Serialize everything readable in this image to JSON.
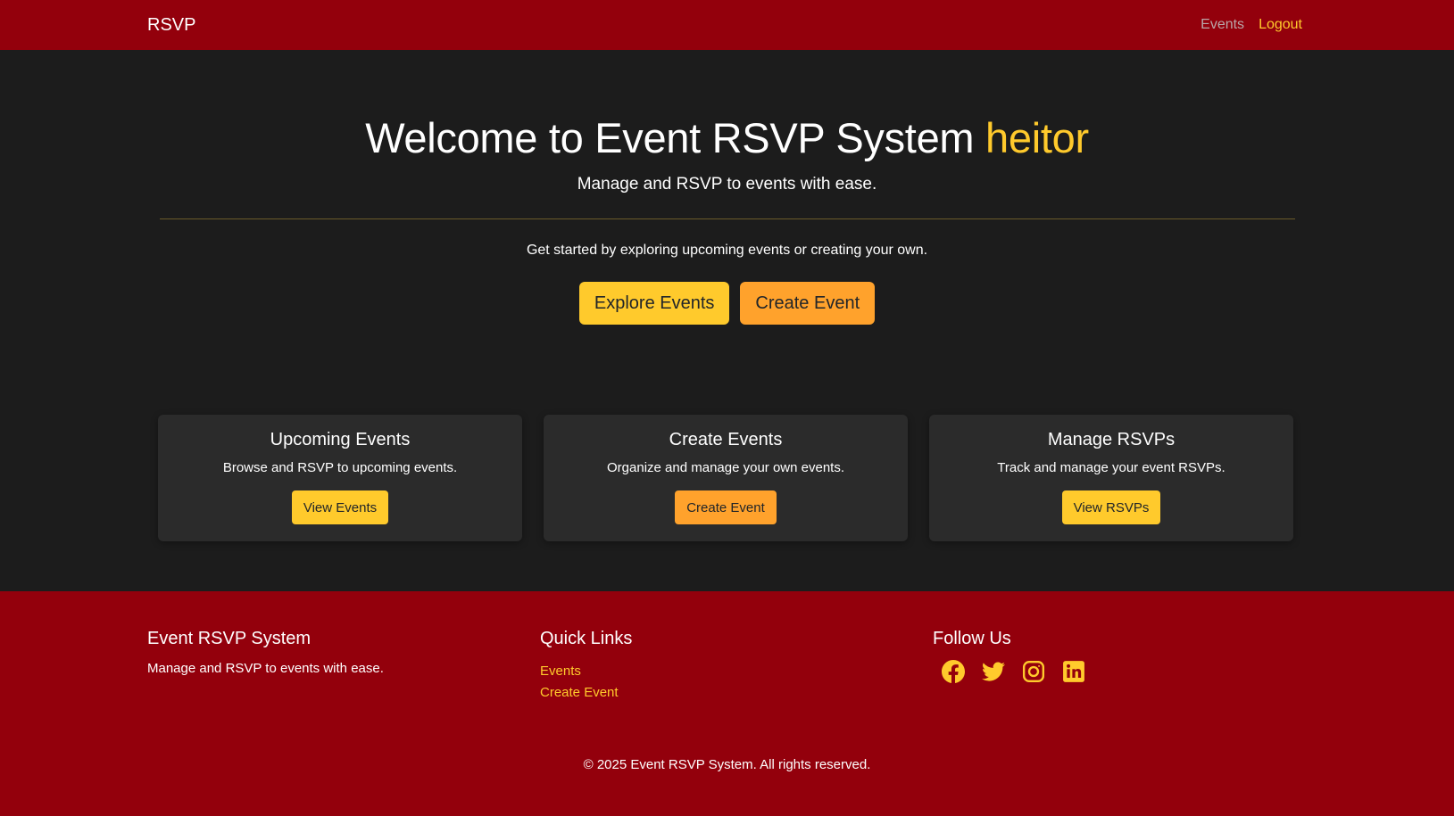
{
  "navbar": {
    "brand": "RSVP",
    "links": [
      {
        "label": "Events"
      },
      {
        "label": "Logout"
      }
    ]
  },
  "hero": {
    "title": "Welcome to Event RSVP System ",
    "username": "heitor",
    "subtitle": "Manage and RSVP to events with ease.",
    "intro": "Get started by exploring upcoming events or creating your own.",
    "buttons": {
      "explore": "Explore Events",
      "create": "Create Event"
    }
  },
  "cards": [
    {
      "title": "Upcoming Events",
      "text": "Browse and RSVP to upcoming events.",
      "button": "View Events"
    },
    {
      "title": "Create Events",
      "text": "Organize and manage your own events.",
      "button": "Create Event"
    },
    {
      "title": "Manage RSVPs",
      "text": "Track and manage your event RSVPs.",
      "button": "View RSVPs"
    }
  ],
  "footer": {
    "about": {
      "title": "Event RSVP System",
      "text": "Manage and RSVP to events with ease."
    },
    "quick_links": {
      "title": "Quick Links",
      "links": [
        "Events",
        "Create Event"
      ]
    },
    "follow": {
      "title": "Follow Us",
      "icons": [
        "facebook-icon",
        "twitter-icon",
        "instagram-icon",
        "linkedin-icon"
      ]
    },
    "copyright": "© 2025 Event RSVP System. All rights reserved."
  },
  "colors": {
    "navbar_bg": "#93000c",
    "page_bg": "#1c1c1c",
    "card_bg": "#2b2b2b",
    "accent_yellow": "#ffca2c",
    "accent_orange": "#ffa22c"
  }
}
